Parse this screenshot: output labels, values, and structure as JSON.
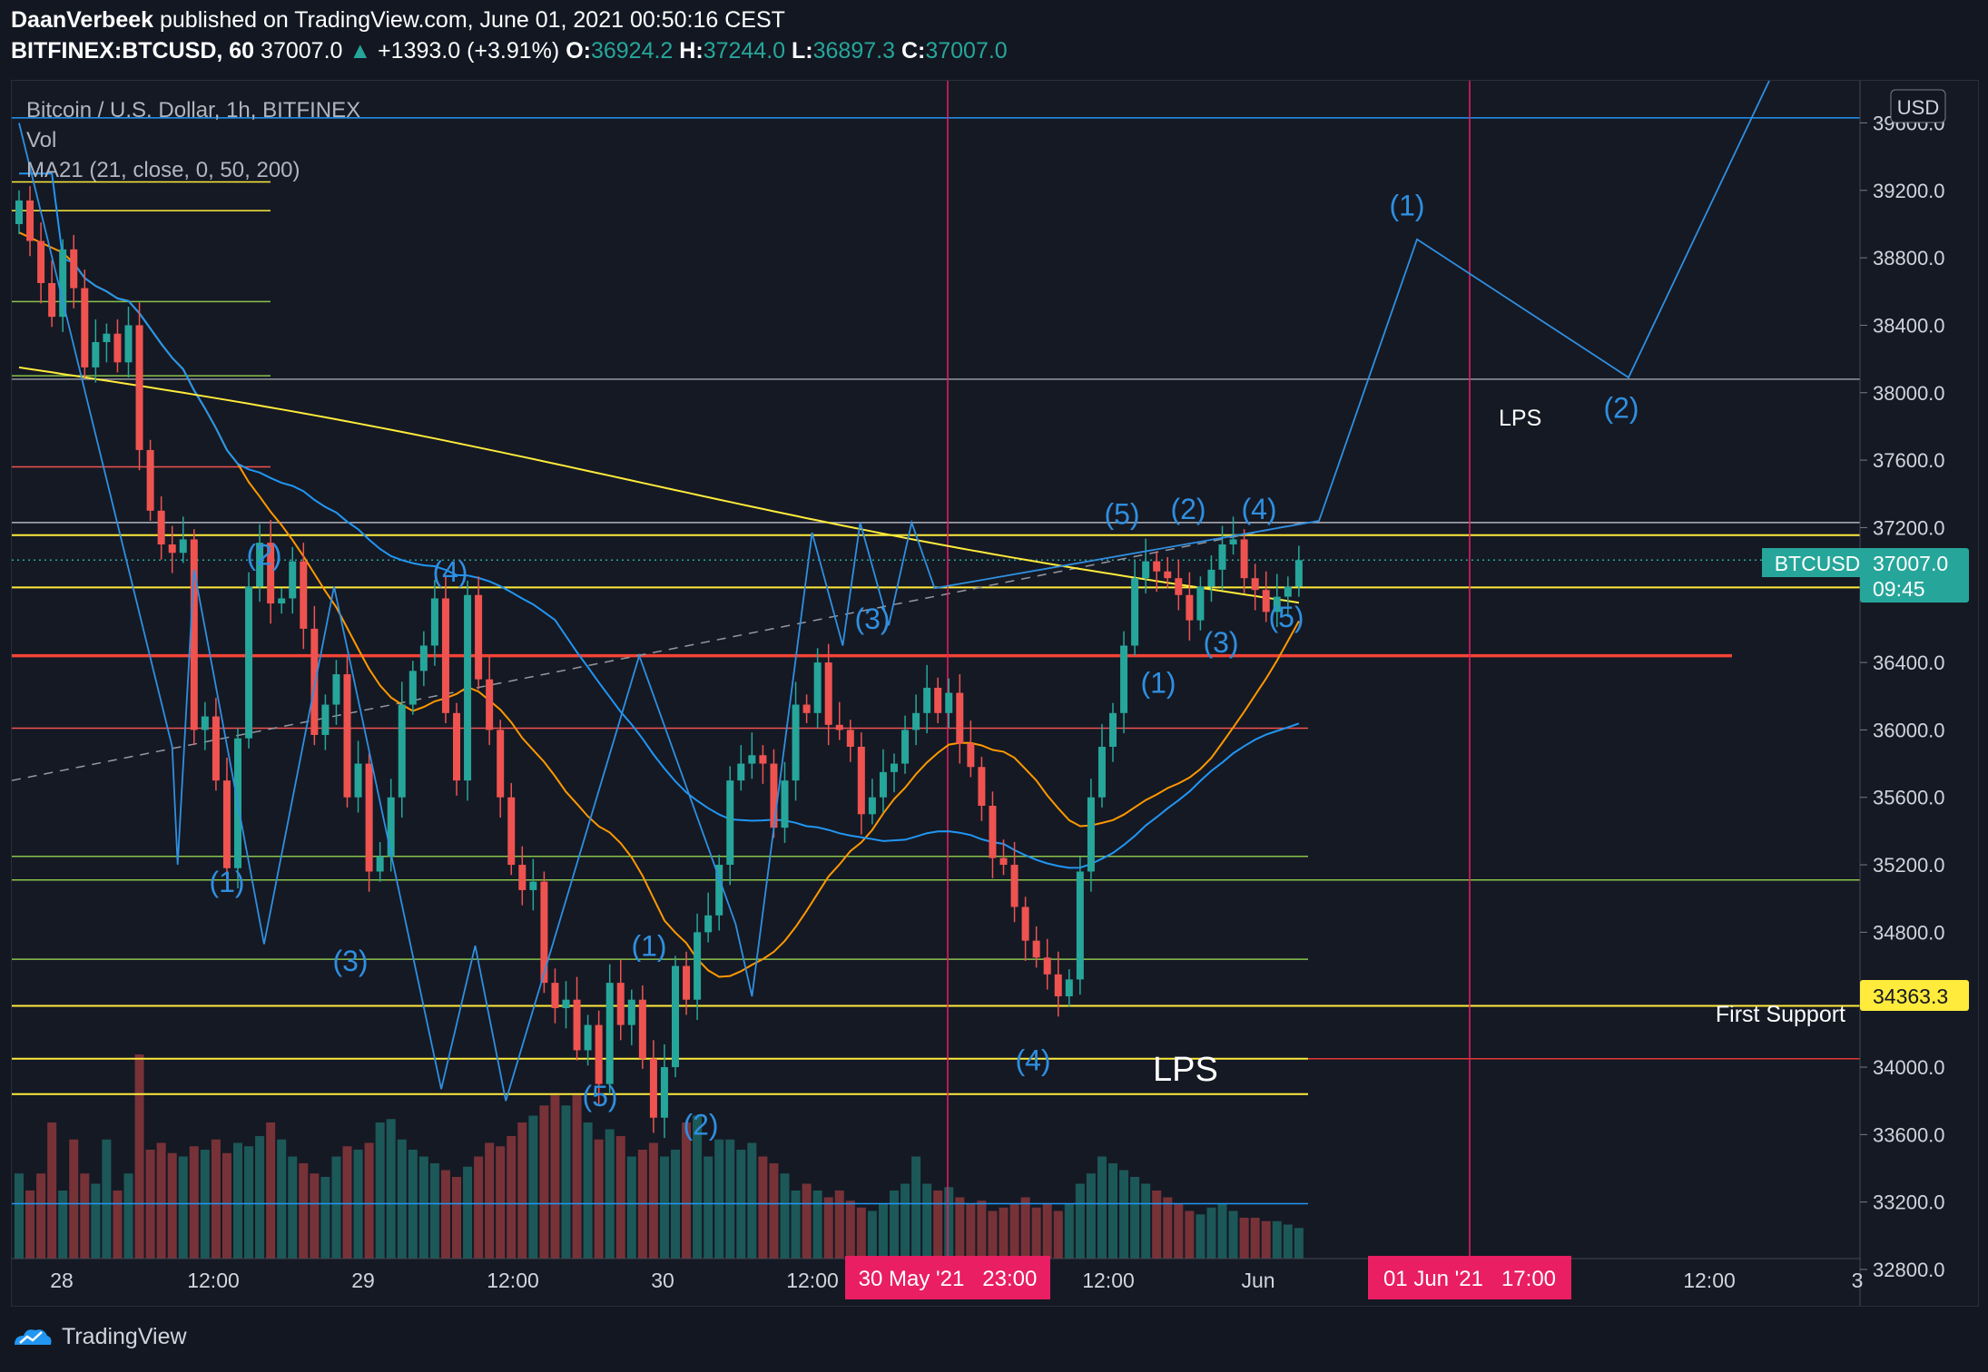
{
  "header": {
    "author": "DaanVerbeek",
    "published": "published on TradingView.com, June 01, 2021 00:50:16 CEST",
    "symbol": "BITFINEX:BTCUSD, 60",
    "last": "37007.0",
    "change": "+1393.0 (+3.91%)",
    "o_label": "O:",
    "o": "36924.2",
    "h_label": "H:",
    "h": "37244.0",
    "l_label": "L:",
    "l": "36897.3",
    "c_label": "C:",
    "c": "37007.0"
  },
  "legend": {
    "title": "Bitcoin / U.S. Dollar, 1h, BITFINEX",
    "vol": "Vol",
    "ma": "MA21 (21, close, 0, 50, 200)"
  },
  "currency": "USD",
  "price_tag": {
    "symbol": "BTCUSD",
    "price": "37007.0",
    "countdown": "09:45"
  },
  "support_tag": {
    "price": "34363.3",
    "label": "First Support"
  },
  "date_badges": [
    "30 May '21   23:00",
    "01 Jun '21   17:00"
  ],
  "annotations": {
    "lps_small": "LPS",
    "lps_big": "LPS"
  },
  "footer": {
    "brand": "TradingView"
  },
  "colors": {
    "background": "#131722",
    "up": "#26a69a",
    "down": "#ef5350",
    "ma_blue": "#2196f3",
    "ma_orange": "#ff9800",
    "ma_yellow": "#ffeb3b",
    "wave": "#2f8fe0",
    "badge": "#e91e63"
  },
  "chart_data": {
    "type": "candlestick",
    "title": "Bitcoin / U.S. Dollar, 1h, BITFINEX",
    "ylabel": "USD",
    "ylim": [
      32800,
      39850
    ],
    "yticks": [
      "39600.0",
      "39200.0",
      "38800.0",
      "38400.0",
      "38000.0",
      "37600.0",
      "37200.0",
      "36800.0",
      "36400.0",
      "36000.0",
      "35600.0",
      "35200.0",
      "34800.0",
      "34400.0",
      "34000.0",
      "33600.0",
      "33200.0",
      "32800.0"
    ],
    "xticks": [
      "28",
      "12:00",
      "29",
      "12:00",
      "30",
      "12:00",
      "30 May '21",
      "12:00",
      "Jun",
      "01 Jun '21",
      "12:00",
      "3"
    ],
    "close": [
      39140,
      38900,
      38650,
      38450,
      38850,
      38620,
      38150,
      38300,
      38350,
      38180,
      38400,
      37660,
      37300,
      37100,
      37050,
      37130,
      36000,
      36080,
      35700,
      35180,
      35950,
      36850,
      37110,
      36750,
      36780,
      37000,
      36600,
      35970,
      36150,
      36330,
      35600,
      35800,
      35160,
      35250,
      35600,
      36150,
      36350,
      36500,
      36780,
      36100,
      35700,
      36800,
      36300,
      36000,
      35600,
      35200,
      35050,
      35100,
      34500,
      34350,
      34400,
      34100,
      34250,
      33900,
      34500,
      34250,
      34400,
      34050,
      33700,
      34000,
      34600,
      34400,
      34800,
      34900,
      35200,
      35700,
      35800,
      35850,
      35800,
      35420,
      35700,
      36150,
      36100,
      36400,
      36030,
      36000,
      35900,
      35500,
      35600,
      35750,
      35800,
      36000,
      36100,
      36250,
      36100,
      36220,
      35920,
      35780,
      35550,
      35240,
      35200,
      34950,
      34750,
      34650,
      34550,
      34420,
      34520,
      35160,
      35600,
      35900,
      36100,
      36500,
      36900,
      37000,
      36940,
      36900,
      36800,
      36650,
      36850,
      36950,
      37100,
      37130,
      36900,
      36830,
      36700,
      36790,
      36850,
      37007
    ],
    "volume": [
      0.25,
      0.2,
      0.25,
      0.4,
      0.2,
      0.35,
      0.25,
      0.22,
      0.35,
      0.2,
      0.25,
      0.6,
      0.32,
      0.34,
      0.31,
      0.3,
      0.33,
      0.32,
      0.35,
      0.31,
      0.34,
      0.33,
      0.36,
      0.4,
      0.35,
      0.3,
      0.28,
      0.25,
      0.24,
      0.3,
      0.33,
      0.32,
      0.34,
      0.4,
      0.41,
      0.35,
      0.32,
      0.3,
      0.28,
      0.26,
      0.24,
      0.27,
      0.3,
      0.34,
      0.33,
      0.36,
      0.4,
      0.42,
      0.45,
      0.48,
      0.45,
      0.48,
      0.4,
      0.35,
      0.38,
      0.36,
      0.3,
      0.32,
      0.34,
      0.3,
      0.32,
      0.4,
      0.42,
      0.3,
      0.35,
      0.35,
      0.32,
      0.34,
      0.3,
      0.28,
      0.25,
      0.2,
      0.22,
      0.2,
      0.18,
      0.2,
      0.17,
      0.15,
      0.14,
      0.16,
      0.2,
      0.22,
      0.3,
      0.22,
      0.2,
      0.21,
      0.18,
      0.16,
      0.17,
      0.14,
      0.15,
      0.16,
      0.18,
      0.15,
      0.16,
      0.14,
      0.16,
      0.22,
      0.25,
      0.3,
      0.28,
      0.26,
      0.24,
      0.22,
      0.2,
      0.18,
      0.16,
      0.14,
      0.13,
      0.15,
      0.16,
      0.14,
      0.12,
      0.12,
      0.11,
      0.11,
      0.1,
      0.09
    ],
    "wave_labels": [
      {
        "text": "(1)",
        "price": 35040
      },
      {
        "text": "(2)",
        "price": 36980
      },
      {
        "text": "(3)",
        "price": 34570
      },
      {
        "text": "(4)",
        "price": 36880
      },
      {
        "text": "(5)",
        "price": 33770
      },
      {
        "text": "(1)",
        "price": 34660
      },
      {
        "text": "(2)",
        "price": 33600
      },
      {
        "text": "(3)",
        "price": 36600
      },
      {
        "text": "(4)",
        "price": 33980
      },
      {
        "text": "(5)",
        "price": 37220
      },
      {
        "text": "(2)",
        "price": 37250
      },
      {
        "text": "(4)",
        "price": 37250
      },
      {
        "text": "(1)",
        "price": 36220
      },
      {
        "text": "(3)",
        "price": 36460
      },
      {
        "text": "(5)",
        "price": 36610
      },
      {
        "text": "(1)",
        "price": 39050
      },
      {
        "text": "(2)",
        "price": 37850
      }
    ],
    "levels": [
      39630,
      38080,
      37230,
      37155,
      36845,
      36440,
      36010,
      35250,
      35110,
      34640,
      34363.3,
      34050,
      33840,
      33190
    ],
    "projection": [
      37007,
      36840,
      37240,
      38910,
      38090,
      39850
    ]
  }
}
